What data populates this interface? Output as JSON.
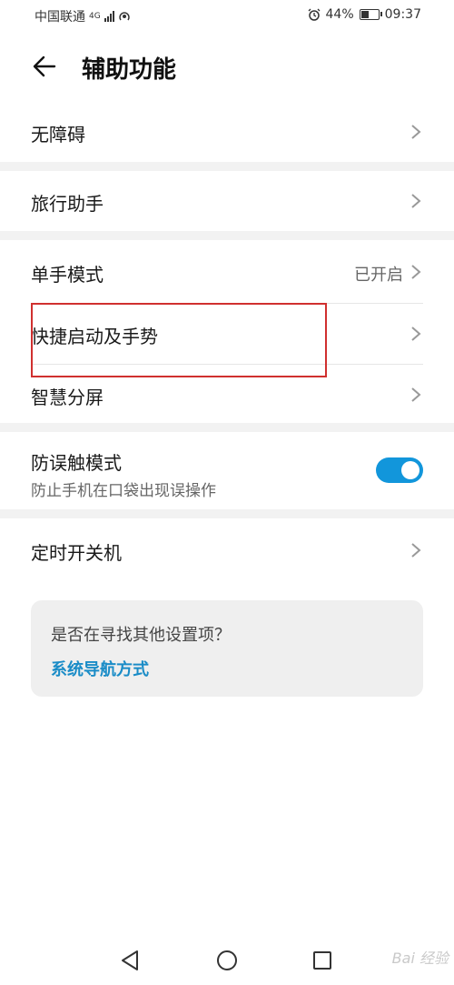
{
  "status_bar": {
    "carrier": "中国联通",
    "network": "4G",
    "alarm": "alarm-icon",
    "battery": "44%",
    "battery_level": 0.44,
    "time": "09:37"
  },
  "header": {
    "back_icon": "arrow-left-icon",
    "title": "辅助功能"
  },
  "rows": {
    "accessibility": {
      "label": "无障碍"
    },
    "travel": {
      "label": "旅行助手"
    },
    "one_hand": {
      "label": "单手模式",
      "value": "已开启"
    },
    "shortcut": {
      "label": "快捷启动及手势"
    },
    "split_screen": {
      "label": "智慧分屏"
    },
    "pocket_mode": {
      "label": "防误触模式",
      "sub": "防止手机在口袋出现误操作",
      "enabled": true
    },
    "scheduled_power": {
      "label": "定时开关机"
    }
  },
  "card": {
    "question": "是否在寻找其他设置项？",
    "link": "系统导航方式"
  },
  "colors": {
    "accent": "#1296db",
    "link": "#1a8cc7",
    "highlight": "#d0302f"
  },
  "nav_bar": {
    "back": "triangle-back-icon",
    "home": "circle-home-icon",
    "recents": "square-recents-icon"
  },
  "watermark": "Bai 经验"
}
